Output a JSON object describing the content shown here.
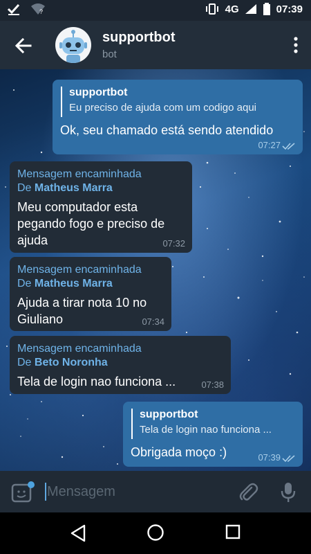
{
  "status_bar": {
    "network": "4G",
    "time": "07:39"
  },
  "header": {
    "title": "supportbot",
    "subtitle": "bot"
  },
  "messages": [
    {
      "reply_name": "supportbot",
      "reply_text": "Eu preciso de ajuda com um codigo aqui",
      "text": "Ok, seu chamado está sendo atendido",
      "time": "07:27"
    },
    {
      "forward_title": "Mensagem encaminhada",
      "from_prefix": "De",
      "from_name": "Matheus Marra",
      "text_lines": [
        "Meu computador esta",
        "pegando fogo e preciso de",
        "ajuda"
      ],
      "time": "07:32"
    },
    {
      "forward_title": "Mensagem encaminhada",
      "from_prefix": "De",
      "from_name": "Matheus Marra",
      "text_lines": [
        "Ajuda a tirar nota 10 no",
        "Giuliano"
      ],
      "time": "07:34"
    },
    {
      "forward_title": "Mensagem encaminhada",
      "from_prefix": "De",
      "from_name": "Beto Noronha",
      "text": "Tela de login nao funciona ...",
      "time": "07:38"
    },
    {
      "reply_name": "supportbot",
      "reply_text": "Tela de login nao funciona ...",
      "text": "Obrigada moço :)",
      "time": "07:39"
    }
  ],
  "input": {
    "placeholder": "Mensagem"
  },
  "colors": {
    "incoming": "#222c37",
    "outgoing": "#2f6ea5",
    "link": "#6fb3e8"
  }
}
